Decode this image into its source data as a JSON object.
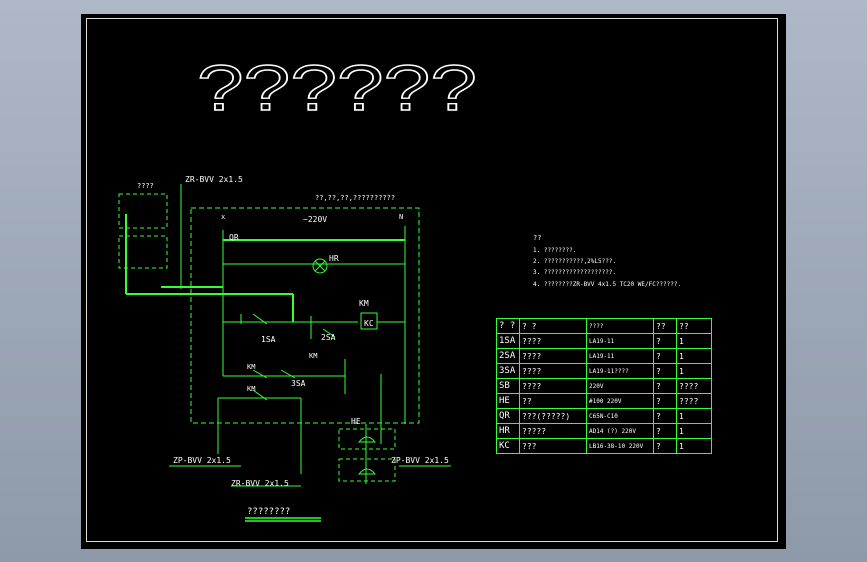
{
  "title_text": "??????",
  "labels": {
    "box_label": "????",
    "cable_top": "ZR-BVV 2x1.5",
    "circuit_note": "??,??,??,??????????",
    "phase_x": "x",
    "phase_n": "N",
    "voltage": "~220V",
    "qr": "QR",
    "hr": "HR",
    "km_coil": "KM",
    "kc": "KC",
    "sa1": "1SA",
    "sa2": "2SA",
    "km1": "KM",
    "km2": "KM",
    "sa3": "3SA",
    "km3": "KM",
    "he": "HE",
    "cable_left": "ZP-BVV 2x1.5",
    "cable_right": "ZP-BVV 2x1.5",
    "cable_bottom": "ZR-BVV 2x1.5",
    "drawing_name": "????????"
  },
  "notes": {
    "heading": "??",
    "lines": [
      "1. ????????.",
      "2. ???????????,2%L5???.",
      "3. ???????????????????.",
      "4. ????????ZR-BVV 4x1.5 TC20 WE/FC??????."
    ]
  },
  "table": {
    "header": [
      "? ?",
      "?  ?",
      "????",
      "??",
      "??"
    ],
    "rows": [
      [
        "1SA",
        "????",
        "LA19-11",
        "?",
        "1"
      ],
      [
        "2SA",
        "????",
        "LA19-11",
        "?",
        "1"
      ],
      [
        "3SA",
        "????",
        "LA19-11????",
        "?",
        "1"
      ],
      [
        "SB",
        "????",
        "220V",
        "?",
        "????"
      ],
      [
        "HE",
        "??",
        "#100 220V",
        "?",
        "????"
      ],
      [
        "QR",
        "???(?????)",
        "C65N-C10",
        "?",
        "1"
      ],
      [
        "HR",
        "?????",
        "AD14 (?) 220V",
        "?",
        "1"
      ],
      [
        "KC",
        "???",
        "LB16-38-10 220V",
        "?",
        "1"
      ]
    ]
  },
  "colors": {
    "line": "#33ff33",
    "text": "#ffffff",
    "background": "#000000",
    "page": "#9ea9b8"
  }
}
